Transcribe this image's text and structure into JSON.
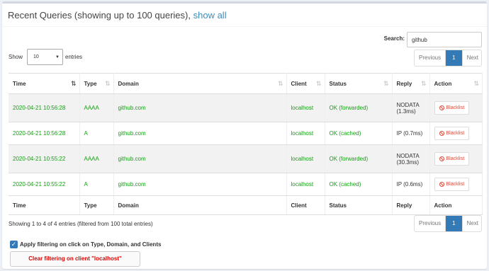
{
  "header": {
    "title": "Recent Queries (showing up to 100 queries),",
    "show_all": "show all"
  },
  "search": {
    "label": "Search:",
    "value": "github"
  },
  "length": {
    "show_label": "Show",
    "selected": "10",
    "entries_label": "entries"
  },
  "pager": {
    "previous": "Previous",
    "current": "1",
    "next": "Next"
  },
  "table": {
    "columns": [
      "Time",
      "Type",
      "Domain",
      "Client",
      "Status",
      "Reply",
      "Action"
    ],
    "rows": [
      {
        "time": "2020-04-21 10:56:28",
        "type": "AAAA",
        "domain": "github.com",
        "client": "localhost",
        "status": "OK (forwarded)",
        "reply_line1": "NODATA",
        "reply_line2": "(1.3ms)",
        "action": "Blacklist"
      },
      {
        "time": "2020-04-21 10:56:28",
        "type": "A",
        "domain": "github.com",
        "client": "localhost",
        "status": "OK (cached)",
        "reply_line1": "IP (0.7ms)",
        "reply_line2": "",
        "action": "Blacklist"
      },
      {
        "time": "2020-04-21 10:55:22",
        "type": "AAAA",
        "domain": "github.com",
        "client": "localhost",
        "status": "OK (forwarded)",
        "reply_line1": "NODATA",
        "reply_line2": "(30.3ms)",
        "action": "Blacklist"
      },
      {
        "time": "2020-04-21 10:55:22",
        "type": "A",
        "domain": "github.com",
        "client": "localhost",
        "status": "OK (cached)",
        "reply_line1": "IP (0.6ms)",
        "reply_line2": "",
        "action": "Blacklist"
      }
    ]
  },
  "info": "Showing 1 to 4 of 4 entries (filtered from 100 total entries)",
  "filter_checkbox": {
    "checked": true,
    "label": "Apply filtering on click on Type, Domain, and Clients"
  },
  "clear_button": "Clear filtering on client \"localhost\"",
  "colors": {
    "ok_green": "#12a112",
    "accent_blue": "#337ab7",
    "danger_red": "#dd4b39"
  }
}
